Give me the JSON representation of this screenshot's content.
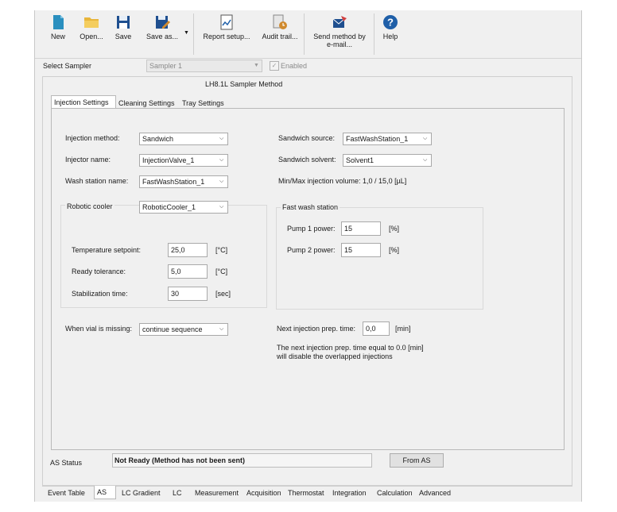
{
  "toolbar": {
    "new": "New",
    "open": "Open...",
    "save": "Save",
    "save_as": "Save as...",
    "report_setup": "Report setup...",
    "audit_trail": "Audit trail...",
    "send_method": "Send method by\ne-mail...",
    "help": "Help"
  },
  "sampler": {
    "label": "Select Sampler",
    "value": "Sampler 1",
    "enabled_label": "Enabled",
    "enabled_checked": true
  },
  "method_title": "LH8.1L Sampler Method",
  "tabs": [
    "Injection Settings",
    "Cleaning Settings",
    "Tray Settings"
  ],
  "form": {
    "injection_method_label": "Injection method:",
    "injection_method_value": "Sandwich",
    "injector_name_label": "Injector name:",
    "injector_name_value": "InjectionValve_1",
    "wash_station_label": "Wash station name:",
    "wash_station_value": "FastWashStation_1",
    "sandwich_source_label": "Sandwich source:",
    "sandwich_source_value": "FastWashStation_1",
    "sandwich_solvent_label": "Sandwich solvent:",
    "sandwich_solvent_value": "Solvent1",
    "minmax_label": "Min/Max injection volume: 1,0 / 15,0 [µL]",
    "robotic_cooler_label": "Robotic cooler",
    "robotic_cooler_value": "RoboticCooler_1",
    "temp_label": "Temperature setpoint:",
    "temp_value": "25,0",
    "temp_unit": "[°C]",
    "ready_label": "Ready tolerance:",
    "ready_value": "5,0",
    "ready_unit": "[°C]",
    "stab_label": "Stabilization time:",
    "stab_value": "30",
    "stab_unit": "[sec]",
    "fast_wash_label": "Fast wash station",
    "pump1_label": "Pump 1 power:",
    "pump1_value": "15",
    "pump1_unit": "[%]",
    "pump2_label": "Pump 2 power:",
    "pump2_value": "15",
    "pump2_unit": "[%]",
    "vial_missing_label": "When vial is missing:",
    "vial_missing_value": "continue sequence",
    "next_prep_label": "Next injection prep. time:",
    "next_prep_value": "0,0",
    "next_prep_unit": "[min]",
    "note_line1": "The next injection prep. time equal to 0.0 [min]",
    "note_line2": "will disable the overlapped injections"
  },
  "status": {
    "label": "AS Status",
    "value": "Not Ready (Method has not been sent)",
    "button": "From AS"
  },
  "bottom_tabs": [
    "Event Table",
    "AS",
    "LC Gradient",
    "LC",
    "Measurement",
    "Acquisition",
    "Thermostat",
    "Integration",
    "Calculation",
    "Advanced"
  ],
  "colors": {
    "accent_blue": "#1f5fa8",
    "folder_yellow": "#e8b53a",
    "help_blue": "#2a6db5"
  }
}
